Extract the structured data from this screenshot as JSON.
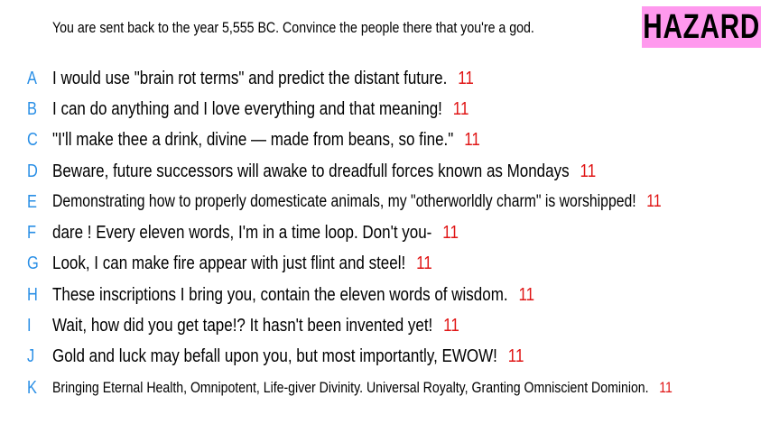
{
  "prompt": "You are sent back to the year 5,555 BC. Convince the people there that you're a god.",
  "badge": "HAZARD",
  "colors": {
    "letter": "#2a8fe6",
    "count": "#e01515",
    "badge_bg": "#ff99ee"
  },
  "options": [
    {
      "letter": "A",
      "text": "I would use \"brain rot terms\" and predict the distant future.",
      "count": "11"
    },
    {
      "letter": "B",
      "text": "I can do anything and I love everything and that meaning!",
      "count": "11"
    },
    {
      "letter": "C",
      "text": "\"I'll make thee a drink, divine — made from beans, so fine.\"",
      "count": "11"
    },
    {
      "letter": "D",
      "text": "Beware, future successors will awake to dreadfull forces known as Mondays",
      "count": "11"
    },
    {
      "letter": "E",
      "text": "Demonstrating how to properly domesticate animals, my \"otherworldly charm\" is worshipped!",
      "count": "11"
    },
    {
      "letter": "F",
      "text": "dare ! Every eleven words, I'm in a time loop. Don't you-",
      "count": "11"
    },
    {
      "letter": "G",
      "text": "Look, I can make fire appear with just flint and steel!",
      "count": "11"
    },
    {
      "letter": "H",
      "text": "These inscriptions I bring you, contain the eleven words of wisdom.",
      "count": "11"
    },
    {
      "letter": "I",
      "text": "Wait, how did you get tape!? It hasn't been invented yet!",
      "count": "11"
    },
    {
      "letter": "J",
      "text": "Gold and luck may befall upon you, but most importantly, EWOW!",
      "count": "11"
    },
    {
      "letter": "K",
      "text": "Bringing Eternal Health, Omnipotent, Life-giver Divinity. Universal Royalty, Granting Omniscient Dominion.",
      "count": "11"
    }
  ]
}
